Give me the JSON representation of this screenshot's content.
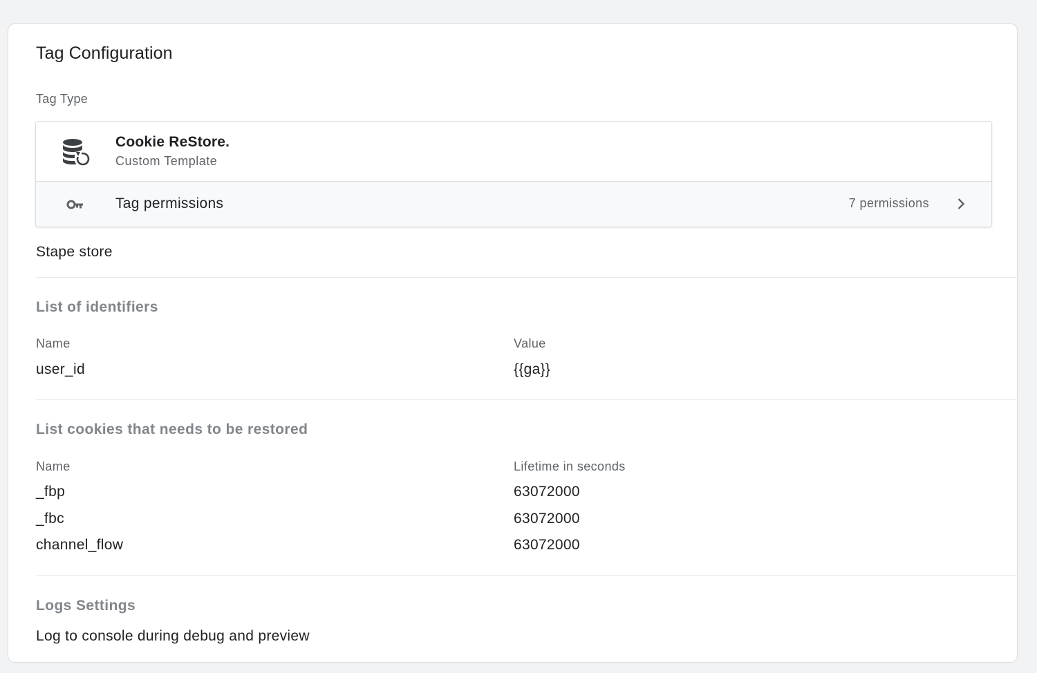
{
  "card": {
    "title": "Tag Configuration",
    "tag_type_label": "Tag Type",
    "tag_type": {
      "name": "Cookie ReStore.",
      "subtitle": "Custom Template",
      "icon": "database-restore-icon"
    },
    "permissions": {
      "label": "Tag permissions",
      "count": "7 permissions",
      "icon": "key-icon"
    },
    "store_text": "Stape store"
  },
  "identifiers": {
    "title": "List of identifiers",
    "headers": [
      "Name",
      "Value"
    ],
    "rows": [
      [
        "user_id",
        "{{ga}}"
      ]
    ]
  },
  "cookies": {
    "title": "List cookies that needs to be restored",
    "headers": [
      "Name",
      "Lifetime in seconds"
    ],
    "rows": [
      [
        "_fbp",
        "63072000"
      ],
      [
        "_fbc",
        "63072000"
      ],
      [
        "channel_flow",
        "63072000"
      ]
    ]
  },
  "logs": {
    "title": "Logs Settings",
    "value": "Log to console during debug and preview"
  }
}
